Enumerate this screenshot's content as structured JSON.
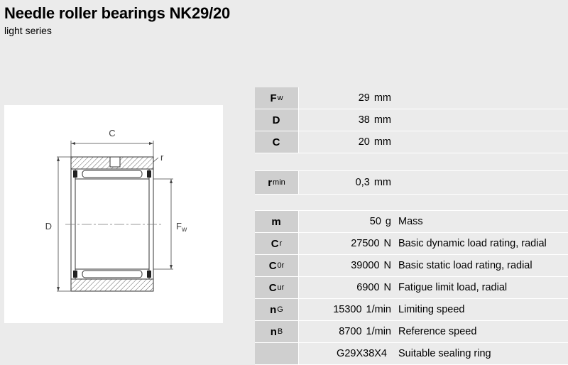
{
  "header": {
    "title": "Needle roller bearings NK29/20",
    "subtitle": "light series"
  },
  "drawing": {
    "label_c": "C",
    "label_r": "r",
    "label_d": "D",
    "label_fw_main": "F",
    "label_fw_sub": "w"
  },
  "dimensions": [
    {
      "sym": "F",
      "sub": "w",
      "value": "29",
      "unit": "mm",
      "desc": ""
    },
    {
      "sym": "D",
      "sub": "",
      "value": "38",
      "unit": "mm",
      "desc": ""
    },
    {
      "sym": "C",
      "sub": "",
      "value": "20",
      "unit": "mm",
      "desc": ""
    }
  ],
  "radius": [
    {
      "sym": "r",
      "sub": "min",
      "value": "0,3",
      "unit": "mm",
      "desc": ""
    }
  ],
  "properties": [
    {
      "sym": "m",
      "sub": "",
      "value": "50",
      "unit": "g",
      "desc": "Mass"
    },
    {
      "sym": "C",
      "sub": "r",
      "value": "27500",
      "unit": "N",
      "desc": "Basic dynamic load rating, radial"
    },
    {
      "sym": "C",
      "sub": "0r",
      "value": "39000",
      "unit": "N",
      "desc": "Basic static load rating, radial"
    },
    {
      "sym": "C",
      "sub": "ur",
      "value": "6900",
      "unit": "N",
      "desc": "Fatigue limit load, radial"
    },
    {
      "sym": "n",
      "sub": "G",
      "value": "15300",
      "unit": "1/min",
      "desc": "Limiting speed"
    },
    {
      "sym": "n",
      "sub": "B",
      "value": "8700",
      "unit": "1/min",
      "desc": "Reference speed"
    },
    {
      "sym": "",
      "sub": "",
      "value": "G29X38X4",
      "unit": "",
      "desc": "Suitable sealing ring"
    }
  ]
}
